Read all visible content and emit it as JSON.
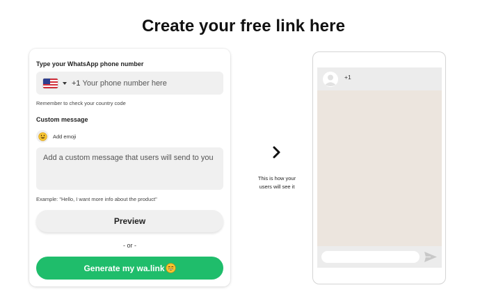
{
  "page": {
    "title": "Create your free link here"
  },
  "form": {
    "phone_label": "Type your WhatsApp phone number",
    "phone_country_flag": "us-flag",
    "phone_dial_code": "+1",
    "phone_placeholder": "Your phone number here",
    "phone_value": "",
    "country_hint": "Remember to check your country code",
    "message_label": "Custom message",
    "emoji_button_label": "Add emoji",
    "message_placeholder": "Add a custom message that users will send to you",
    "message_value": "",
    "example_text": "Example: \"Hello, I want more info about the product\"",
    "preview_button_label": "Preview",
    "or_divider": "- or -",
    "generate_button_label": "Generate my wa.link"
  },
  "preview": {
    "caption": "This is how your users will see it",
    "contact_name": "+1"
  },
  "icons": {
    "next": "chevron-right-icon",
    "emoji": "smiley-emoji-icon",
    "avatar": "user-avatar-icon",
    "send": "send-icon"
  },
  "colors": {
    "accent": "#1fbd6b",
    "field_bg": "#f0f0f0",
    "chat_bg": "#ece5de",
    "chat_bar": "#ececec"
  }
}
